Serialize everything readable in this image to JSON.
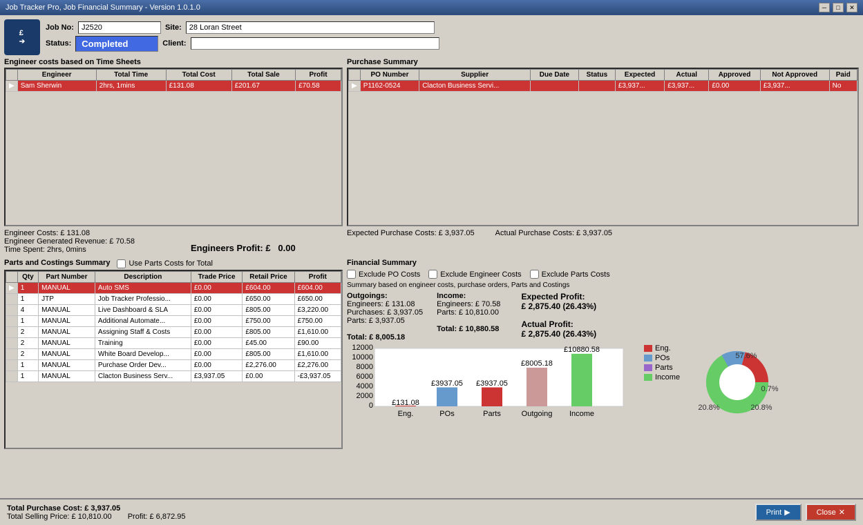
{
  "titleBar": {
    "title": "Job Tracker Pro, Job Financial Summary - Version 1.0.1.0",
    "minimizeIcon": "─",
    "maximizeIcon": "□",
    "closeIcon": "✕"
  },
  "header": {
    "jobNoLabel": "Job No:",
    "jobNoValue": "J2520",
    "siteLabel": "Site:",
    "siteValue": "28 Loran Street",
    "statusLabel": "Status:",
    "statusValue": "Completed",
    "clientLabel": "Client:",
    "clientValue": ""
  },
  "engineerSection": {
    "title": "Engineer costs based on Time Sheets",
    "columns": [
      "Engineer",
      "Total Time",
      "Total Cost",
      "Total Sale",
      "Profit"
    ],
    "rows": [
      {
        "name": "Sam Sherwin",
        "time": "2hrs, 1mins",
        "cost": "£131.08",
        "sale": "£201.67",
        "profit": "£70.58",
        "selected": true
      }
    ],
    "summary": {
      "costs": "Engineer Costs: £ 131.08",
      "revenue": "Engineer Generated Revenue: £ 70.58",
      "time": "Time Spent: 2hrs, 0mins",
      "profit": "Engineers Profit: £   0.00"
    }
  },
  "purchaseSection": {
    "title": "Purchase Summary",
    "columns": [
      "PO Number",
      "Supplier",
      "Due Date",
      "Status",
      "Expected",
      "Actual",
      "Approved",
      "Not Approved",
      "Paid"
    ],
    "rows": [
      {
        "po": "P1162-0524",
        "supplier": "Clacton Business Servi...",
        "dueDate": "",
        "status": "",
        "expected": "£3,937...",
        "actual": "£3,937...",
        "approved": "£0.00",
        "notApproved": "£3,937...",
        "paid": "No",
        "selected": true
      }
    ],
    "summary": {
      "expectedCosts": "Expected Purchase Costs: £ 3,937.05",
      "actualCosts": "Actual Purchase Costs: £ 3,937.05"
    }
  },
  "partsSection": {
    "title": "Parts and Costings Summary",
    "usePartsCostsLabel": "Use Parts Costs for Total",
    "columns": [
      "Qty",
      "Part Number",
      "Description",
      "Trade Price",
      "Retail Price",
      "Profit"
    ],
    "rows": [
      {
        "qty": "1",
        "partNo": "MANUAL",
        "desc": "Auto SMS",
        "trade": "£0.00",
        "retail": "£604.00",
        "profit": "£604.00",
        "selected": true
      },
      {
        "qty": "1",
        "partNo": "JTP",
        "desc": "Job Tracker Professio...",
        "trade": "£0.00",
        "retail": "£650.00",
        "profit": "£650.00",
        "selected": false
      },
      {
        "qty": "4",
        "partNo": "MANUAL",
        "desc": "Live Dashboard & SLA",
        "trade": "£0.00",
        "retail": "£805.00",
        "profit": "£3,220.00",
        "selected": false
      },
      {
        "qty": "1",
        "partNo": "MANUAL",
        "desc": "Additional Automate...",
        "trade": "£0.00",
        "retail": "£750.00",
        "profit": "£750.00",
        "selected": false
      },
      {
        "qty": "2",
        "partNo": "MANUAL",
        "desc": "Assigning Staff & Costs",
        "trade": "£0.00",
        "retail": "£805.00",
        "profit": "£1,610.00",
        "selected": false
      },
      {
        "qty": "2",
        "partNo": "MANUAL",
        "desc": "Training",
        "trade": "£0.00",
        "retail": "£45.00",
        "profit": "£90.00",
        "selected": false
      },
      {
        "qty": "2",
        "partNo": "MANUAL",
        "desc": "White Board Develop...",
        "trade": "£0.00",
        "retail": "£805.00",
        "profit": "£1,610.00",
        "selected": false
      },
      {
        "qty": "1",
        "partNo": "MANUAL",
        "desc": "Purchase Order Dev...",
        "trade": "£0.00",
        "retail": "£2,276.00",
        "profit": "£2,276.00",
        "selected": false
      },
      {
        "qty": "1",
        "partNo": "MANUAL",
        "desc": "Clacton Business Serv...",
        "trade": "£3,937.05",
        "retail": "£0.00",
        "profit": "-£3,937.05",
        "selected": false
      }
    ]
  },
  "financialSection": {
    "title": "Financial Summary",
    "excludePOCosts": "Exclude PO Costs",
    "excludeEngineerCosts": "Exclude Engineer Costs",
    "excludePartsCosts": "Exclude Parts Costs",
    "summaryNote": "Summary based on engineer costs, purchase orders, Parts and Costings",
    "outgoings": {
      "label": "Outgoings:",
      "engineers": "Engineers: £ 131.08",
      "purchases": "Purchases: £ 3,937.05",
      "parts": "Parts: £ 3,937.05",
      "total": "Total: £ 8,005.18"
    },
    "income": {
      "label": "Income:",
      "engineers": "Engineers: £ 70.58",
      "parts": "Parts: £ 10,810.00",
      "total": "Total:  £ 10,880.58"
    },
    "expectedProfit": {
      "label": "Expected Profit:",
      "value": "£ 2,875.40 (26.43%)"
    },
    "actualProfit": {
      "label": "Actual Profit:",
      "value": "£ 2,875.40 (26.43%)"
    },
    "chart": {
      "bars": [
        {
          "label": "Eng.",
          "value": 131.08,
          "display": "£131.08",
          "color": "#cc3333",
          "height": 8
        },
        {
          "label": "POs",
          "value": 3937.05,
          "display": "£3937.05",
          "color": "#6699cc",
          "height": 59
        },
        {
          "label": "Parts",
          "value": 3937.05,
          "display": "£3937.05",
          "color": "#cc3333",
          "height": 59
        },
        {
          "label": "Outgoing",
          "value": 8005.18,
          "display": "£8005.18",
          "color": "#cc6666",
          "height": 89
        },
        {
          "label": "Income",
          "value": 10880.58,
          "display": "£10880.58",
          "color": "#66cc66",
          "height": 100
        }
      ],
      "yLabels": [
        "12000",
        "10000",
        "8000",
        "6000",
        "4000",
        "2000",
        "0"
      ]
    },
    "legend": [
      {
        "label": "Eng.",
        "color": "#cc3333"
      },
      {
        "label": "POs",
        "color": "#6699cc"
      },
      {
        "label": "Parts",
        "color": "#9966cc"
      },
      {
        "label": "Income",
        "color": "#66cc66"
      }
    ],
    "pie": {
      "segments": [
        {
          "label": "57.6%",
          "color": "#66cc66",
          "startAngle": 0,
          "endAngle": 207
        },
        {
          "label": "0.7%",
          "color": "#9966cc",
          "startAngle": 207,
          "endAngle": 210
        },
        {
          "label": "20.8%",
          "color": "#6699cc",
          "startAngle": 210,
          "endAngle": 285
        },
        {
          "label": "20.8%",
          "color": "#cc3333",
          "startAngle": 285,
          "endAngle": 360
        }
      ]
    }
  },
  "footer": {
    "totalPurchaseCost": "Total Purchase Cost: £ 3,937.05",
    "totalSellingPrice": "Total Selling Price: £ 10,810.00",
    "profit": "Profit: £ 6,872.95",
    "printLabel": "Print",
    "closeLabel": "Close"
  }
}
